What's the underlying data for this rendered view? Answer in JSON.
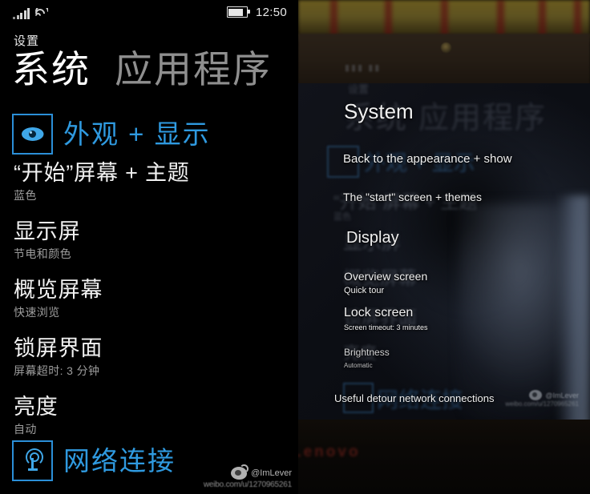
{
  "statusbar": {
    "signal_icon": "signal-bars-icon",
    "wifi_icon": "wifi-icon",
    "battery_icon": "battery-full-icon",
    "time": "12:50"
  },
  "app": {
    "title": "设置",
    "pivots": [
      {
        "label": "系统",
        "active": true
      },
      {
        "label": "应用程序",
        "active": false
      }
    ]
  },
  "groups": {
    "appearance": {
      "icon": "eye-icon",
      "label": "外观 + 显示",
      "color": "#2f9ae0"
    },
    "network": {
      "icon": "antenna-icon",
      "label": "网络连接",
      "color": "#2f9ae0"
    }
  },
  "settings_list": [
    {
      "title": "“开始”屏幕 + 主题",
      "subtitle": "蓝色"
    },
    {
      "title": "显示屏",
      "subtitle": "节电和颜色"
    },
    {
      "title": "概览屏幕",
      "subtitle": "快速浏览"
    },
    {
      "title": "锁屏界面",
      "subtitle": "屏幕超时: 3 分钟"
    },
    {
      "title": "亮度",
      "subtitle": "自动"
    }
  ],
  "watermark": {
    "logo": "weibo-logo-icon",
    "handle": "@ImLever",
    "url": "weibo.com/u/1270965261"
  },
  "photo": {
    "device_brand": "Lenovo",
    "ghost_app_title": "设置",
    "ghost_pivots": [
      "系统",
      "应用程序"
    ],
    "ghost_items": [
      "外观 + 显示",
      "“开始”屏幕 + 主题",
      "蓝色",
      "显示屏",
      "概览屏幕",
      "锁屏界面",
      "亮度",
      "网络连接"
    ],
    "overlays": [
      {
        "text": "System",
        "size": 26
      },
      {
        "text": "Back to the appearance + show",
        "size": 15
      },
      {
        "text": "The \"start\" screen + themes",
        "size": 14
      },
      {
        "text": "Display",
        "size": 20
      },
      {
        "text": "Overview screen",
        "size": 14
      },
      {
        "text": "Quick tour",
        "size": 11
      },
      {
        "text": "Lock screen",
        "size": 16
      },
      {
        "text": "Screen timeout: 3 minutes",
        "size": 9
      },
      {
        "text": "Brightness",
        "size": 12
      },
      {
        "text": "Automatic",
        "size": 8
      },
      {
        "text": "Useful detour network connections",
        "size": 13
      }
    ],
    "watermark_handle": "@ImLever",
    "watermark_url": "weibo.com/u/1270965261"
  }
}
